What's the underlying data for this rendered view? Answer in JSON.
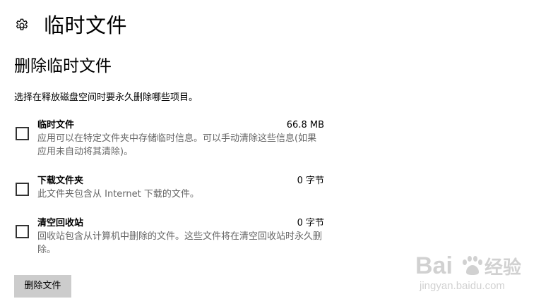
{
  "header": {
    "title": "临时文件",
    "icon": "gear-icon"
  },
  "section": {
    "title": "删除临时文件",
    "instruction": "选择在释放磁盘空间时要永久删除哪些项目。"
  },
  "items": [
    {
      "name": "临时文件",
      "size": "66.8 MB",
      "description": "应用可以在特定文件夹中存储临时信息。可以手动清除这些信息(如果应用未自动将其清除)。",
      "checked": false
    },
    {
      "name": "下载文件夹",
      "size": "0 字节",
      "description": "此文件夹包含从 Internet 下载的文件。",
      "checked": false
    },
    {
      "name": "清空回收站",
      "size": "0 字节",
      "description": "回收站包含从计算机中删除的文件。这些文件将在清空回收站时永久删除。",
      "checked": false
    }
  ],
  "actions": {
    "delete_label": "删除文件"
  },
  "watermark": {
    "brand": "Bai",
    "brand_suffix": "经验",
    "url": "jingyan.baidu.com"
  },
  "colors": {
    "background": "#ffffff",
    "text": "#000000",
    "secondary_text": "#666666",
    "button_bg": "#cccccc",
    "checkbox_border": "#333333"
  }
}
